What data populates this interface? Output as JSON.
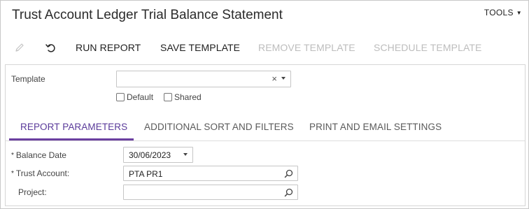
{
  "window": {
    "title": "Trust Account Ledger Trial Balance Statement",
    "tools_label": "TOOLS"
  },
  "toolbar": {
    "edit_icon": "pencil-icon",
    "undo_icon": "undo-icon",
    "run_report": "RUN REPORT",
    "save_template": "SAVE TEMPLATE",
    "remove_template": "REMOVE TEMPLATE",
    "schedule_template": "SCHEDULE TEMPLATE"
  },
  "template_section": {
    "template_label": "Template",
    "template_value": "",
    "default_label": "Default",
    "shared_label": "Shared",
    "default_checked": false,
    "shared_checked": false
  },
  "tabs": [
    {
      "label": "REPORT PARAMETERS",
      "active": true
    },
    {
      "label": "ADDITIONAL SORT AND FILTERS",
      "active": false
    },
    {
      "label": "PRINT AND EMAIL SETTINGS",
      "active": false
    }
  ],
  "parameters": {
    "balance_date_label": "Balance Date",
    "balance_date_value": "30/06/2023",
    "trust_account_label": "Trust Account:",
    "trust_account_value": "PTA PR1",
    "project_label": "Project:",
    "project_value": "",
    "required_marker": "*"
  },
  "colors": {
    "accent": "#6b3fa0",
    "disabled_text": "#bdbdbd"
  }
}
